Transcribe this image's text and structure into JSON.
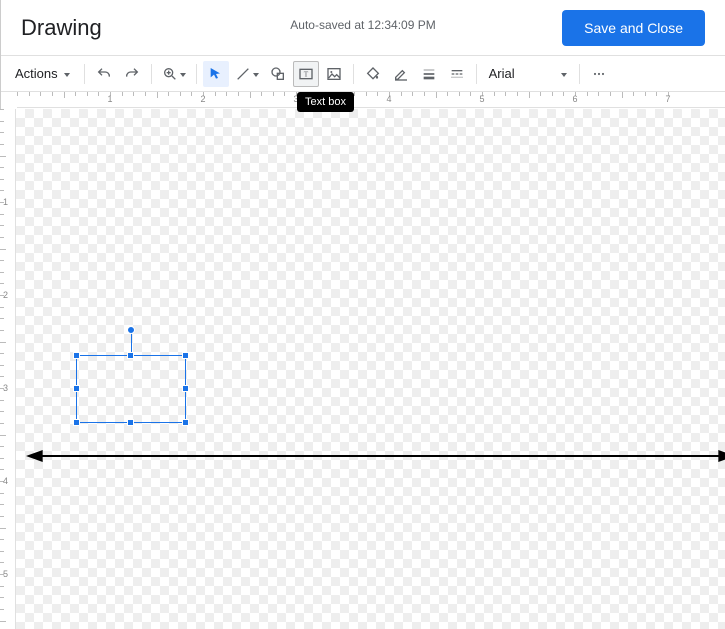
{
  "header": {
    "title": "Drawing",
    "autosave": "Auto-saved at 12:34:09 PM",
    "save_label": "Save and Close"
  },
  "toolbar": {
    "actions_label": "Actions",
    "font_name": "Arial",
    "tooltip": "Text box"
  },
  "icons": {
    "undo": "undo-icon",
    "redo": "redo-icon",
    "zoom": "zoom-icon",
    "select": "select-icon",
    "line": "line-icon",
    "shape": "shape-icon",
    "textbox": "textbox-icon",
    "image": "image-icon",
    "fill": "fill-icon",
    "bordercolor": "border-color-icon",
    "borderweight": "border-weight-icon",
    "borderdash": "border-dash-icon",
    "more": "more-icon"
  },
  "ruler": {
    "h_numbers": [
      1,
      2,
      3,
      4,
      5,
      6,
      7
    ],
    "v_numbers": [
      1,
      2,
      3,
      4,
      5
    ]
  }
}
